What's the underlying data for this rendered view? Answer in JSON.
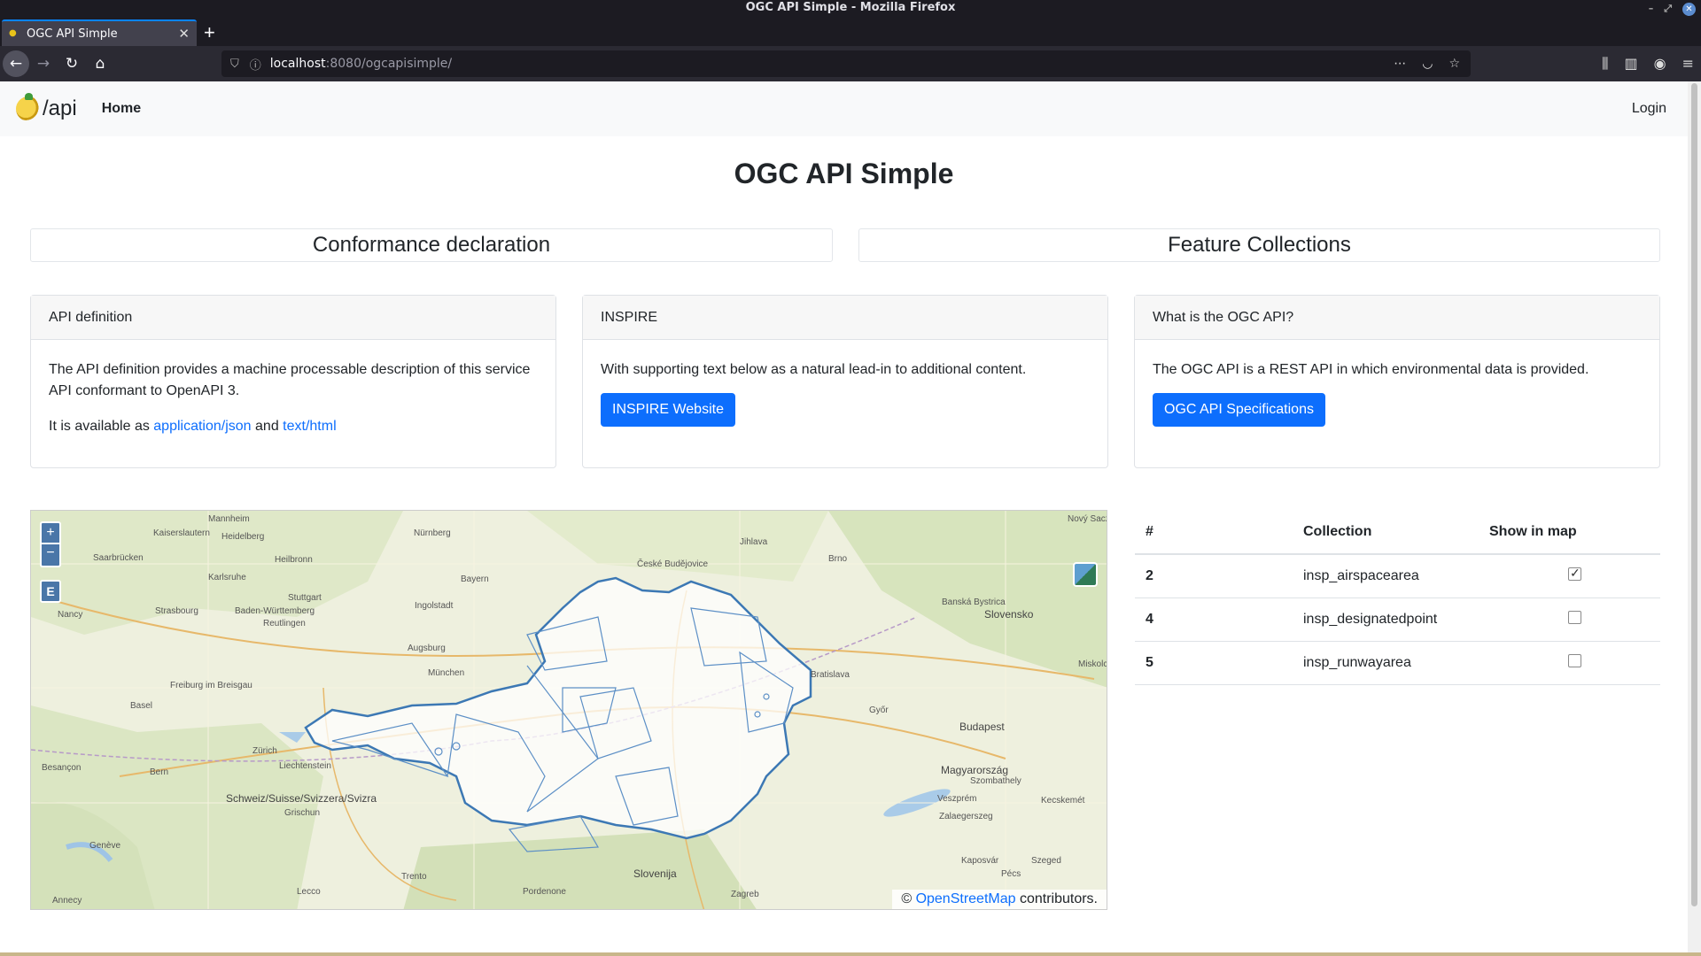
{
  "window": {
    "title": "OGC API Simple - Mozilla Firefox"
  },
  "browser": {
    "tab_title": "OGC API Simple",
    "url_host": "localhost",
    "url_path": ":8080/ogcapisimple/"
  },
  "nav": {
    "brand": "/api",
    "home": "Home",
    "login": "Login"
  },
  "page": {
    "title": "OGC API Simple",
    "links": {
      "conformance": "Conformance declaration",
      "collections": "Feature Collections"
    }
  },
  "cards": [
    {
      "header": "API definition",
      "text1": "The API definition provides a machine processable description of this service API conformant to OpenAPI 3.",
      "text2_prefix": "It is available as ",
      "link1": "application/json",
      "text2_mid": " and ",
      "link2": "text/html"
    },
    {
      "header": "INSPIRE",
      "text": "With supporting text below as a natural lead-in to additional content.",
      "button": "INSPIRE Website"
    },
    {
      "header": "What is the OGC API?",
      "text": "The OGC API is a REST API in which environmental data is provided.",
      "button": "OGC API Specifications"
    }
  ],
  "map": {
    "zoom_in": "+",
    "zoom_out": "−",
    "extent": "E",
    "attribution_prefix": "© ",
    "attribution_link": "OpenStreetMap",
    "attribution_suffix": " contributors.",
    "labels": [
      "Nürnberg",
      "Mannheim",
      "Heidelberg",
      "Kaiserslautern",
      "Saarbrücken",
      "Karlsruhe",
      "Heilbronn",
      "Stuttgart",
      "Strasbourg",
      "Nancy",
      "Reutlingen",
      "Baden-Württemberg",
      "Bayern",
      "Ingolstadt",
      "Augsburg",
      "München",
      "Freiburg im Breisgau",
      "Basel",
      "Zürich",
      "Bern",
      "Schweiz/Suisse/Svizzera/Svizra",
      "Genève",
      "Besançon",
      "Liechtenstein",
      "Trento",
      "Slovenija",
      "Zagreb",
      "Budapest",
      "Magyarország",
      "Slovensko",
      "Brno",
      "Jihlava",
      "České Budějovice",
      "Bratislava",
      "Győr",
      "Banská Bystrica",
      "Szombathely",
      "Veszprém",
      "Zalaegerszeg",
      "Kaposvár",
      "Pécs",
      "Nový Sacz",
      "Miskolc",
      "Kecskemét",
      "Szeged",
      "Lecco",
      "Annecy",
      "Pordenone",
      "Grischun"
    ]
  },
  "table": {
    "headers": [
      "#",
      "Collection",
      "Show in map"
    ],
    "rows": [
      {
        "num": "2",
        "name": "insp_airspacearea",
        "checked": true
      },
      {
        "num": "4",
        "name": "insp_designatedpoint",
        "checked": false
      },
      {
        "num": "5",
        "name": "insp_runwayarea",
        "checked": false
      }
    ]
  }
}
